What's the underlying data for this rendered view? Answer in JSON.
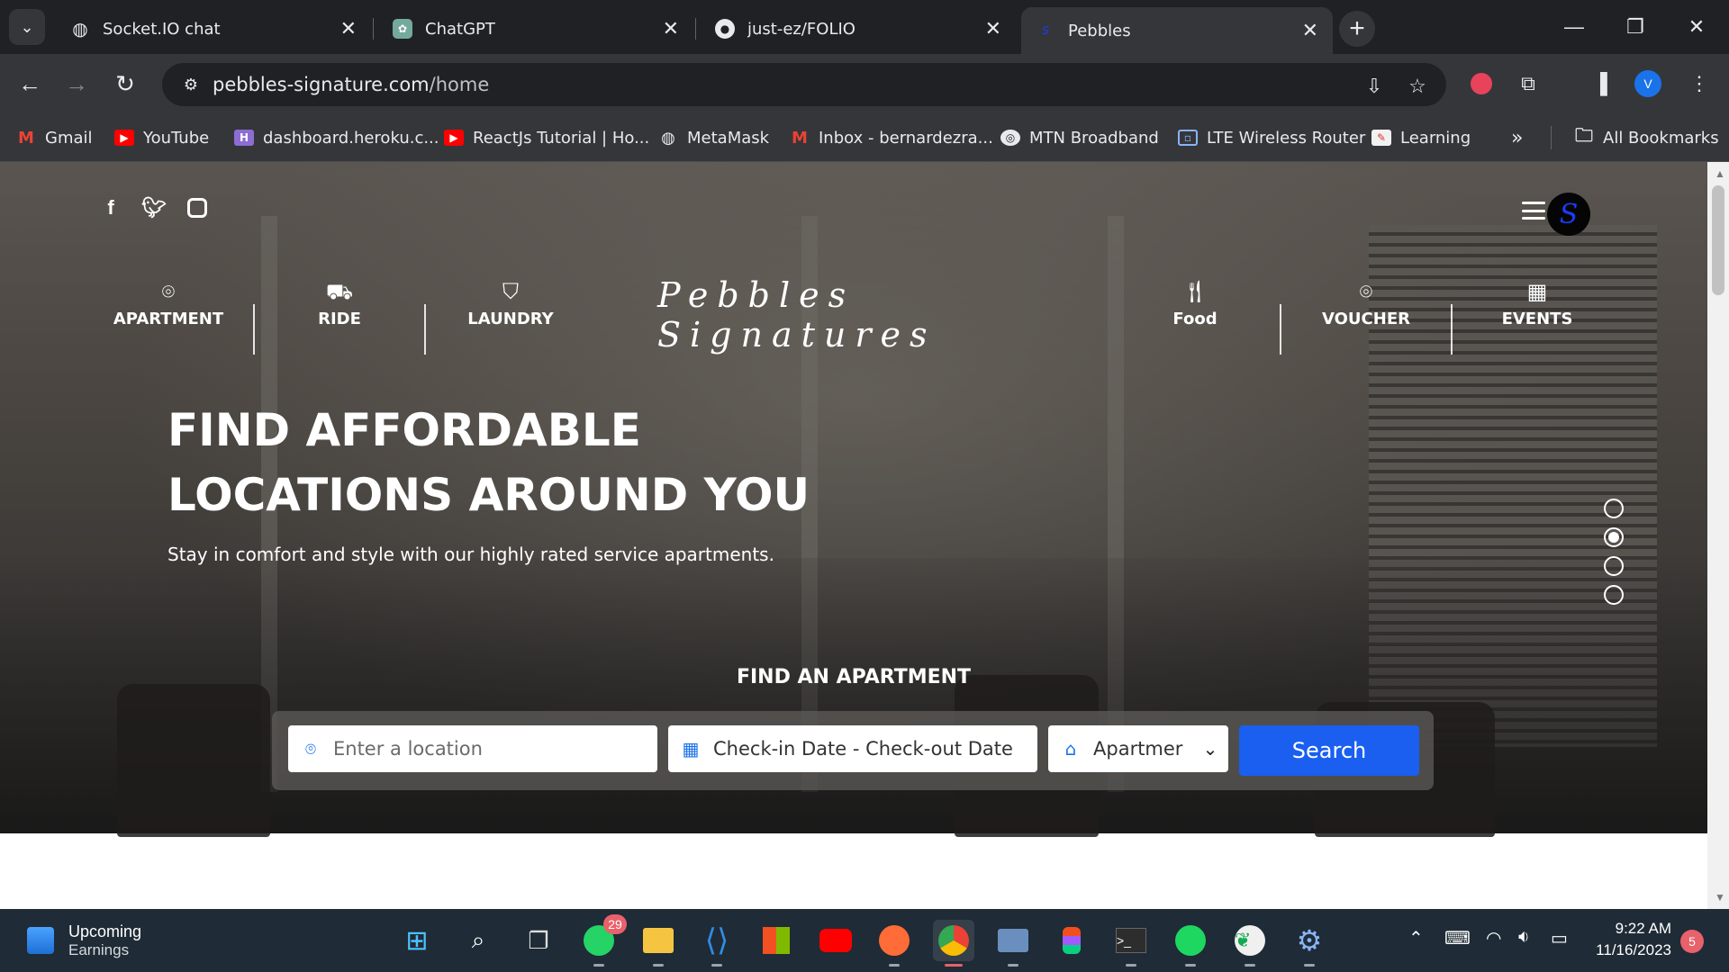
{
  "browser": {
    "tabs": [
      {
        "title": "Socket.IO chat",
        "icon": "globe-icon"
      },
      {
        "title": "ChatGPT",
        "icon": "chatgpt-icon"
      },
      {
        "title": "just-ez/FOLIO",
        "icon": "github-icon"
      },
      {
        "title": "Pebbles",
        "icon": "pebbles-icon",
        "active": true
      }
    ],
    "url_host": "pebbles-signature.com",
    "url_path": "/home",
    "profile_initial": "V",
    "bookmarks": [
      {
        "label": "Gmail",
        "icon": "gmail-icon"
      },
      {
        "label": "YouTube",
        "icon": "youtube-icon"
      },
      {
        "label": "dashboard.heroku.c...",
        "icon": "heroku-icon"
      },
      {
        "label": "ReactJs Tutorial | Ho...",
        "icon": "youtube-icon"
      },
      {
        "label": "MetaMask",
        "icon": "globe-icon"
      },
      {
        "label": "Inbox - bernardezra...",
        "icon": "gmail-icon"
      },
      {
        "label": "MTN Broadband",
        "icon": "router-icon"
      },
      {
        "label": "LTE Wireless Router",
        "icon": "router-icon"
      },
      {
        "label": "Learning",
        "icon": "learning-icon"
      }
    ],
    "all_bookmarks": "All Bookmarks"
  },
  "site": {
    "nav_left": [
      {
        "label": "APARTMENT",
        "icon": "location-pin-icon"
      },
      {
        "label": "RIDE",
        "icon": "car-icon"
      },
      {
        "label": "LAUNDRY",
        "icon": "shirt-icon"
      }
    ],
    "brand": "Pebbles Signatures",
    "nav_right": [
      {
        "label": "Food",
        "icon": "fork-knife-icon"
      },
      {
        "label": "VOUCHER",
        "icon": "location-pin-icon"
      },
      {
        "label": "EVENTS",
        "icon": "calendar-icon"
      }
    ],
    "headline_line1": "FIND AFFORDABLE",
    "headline_line2": "LOCATIONS AROUND YOU",
    "subheadline": "Stay in comfort and style with our highly rated service apartments.",
    "find_title": "FIND AN APARTMENT",
    "location_placeholder": "Enter a location",
    "dates_placeholder": "Check-in Date - Check-out Date",
    "type_value": "Apartmer",
    "search_label": "Search",
    "slide_active": 2,
    "slide_count": 4
  },
  "taskbar": {
    "widget_title": "Upcoming",
    "widget_subtitle": "Earnings",
    "whatsapp_badge": "29",
    "time": "9:22 AM",
    "date": "11/16/2023",
    "notifications": "5"
  }
}
